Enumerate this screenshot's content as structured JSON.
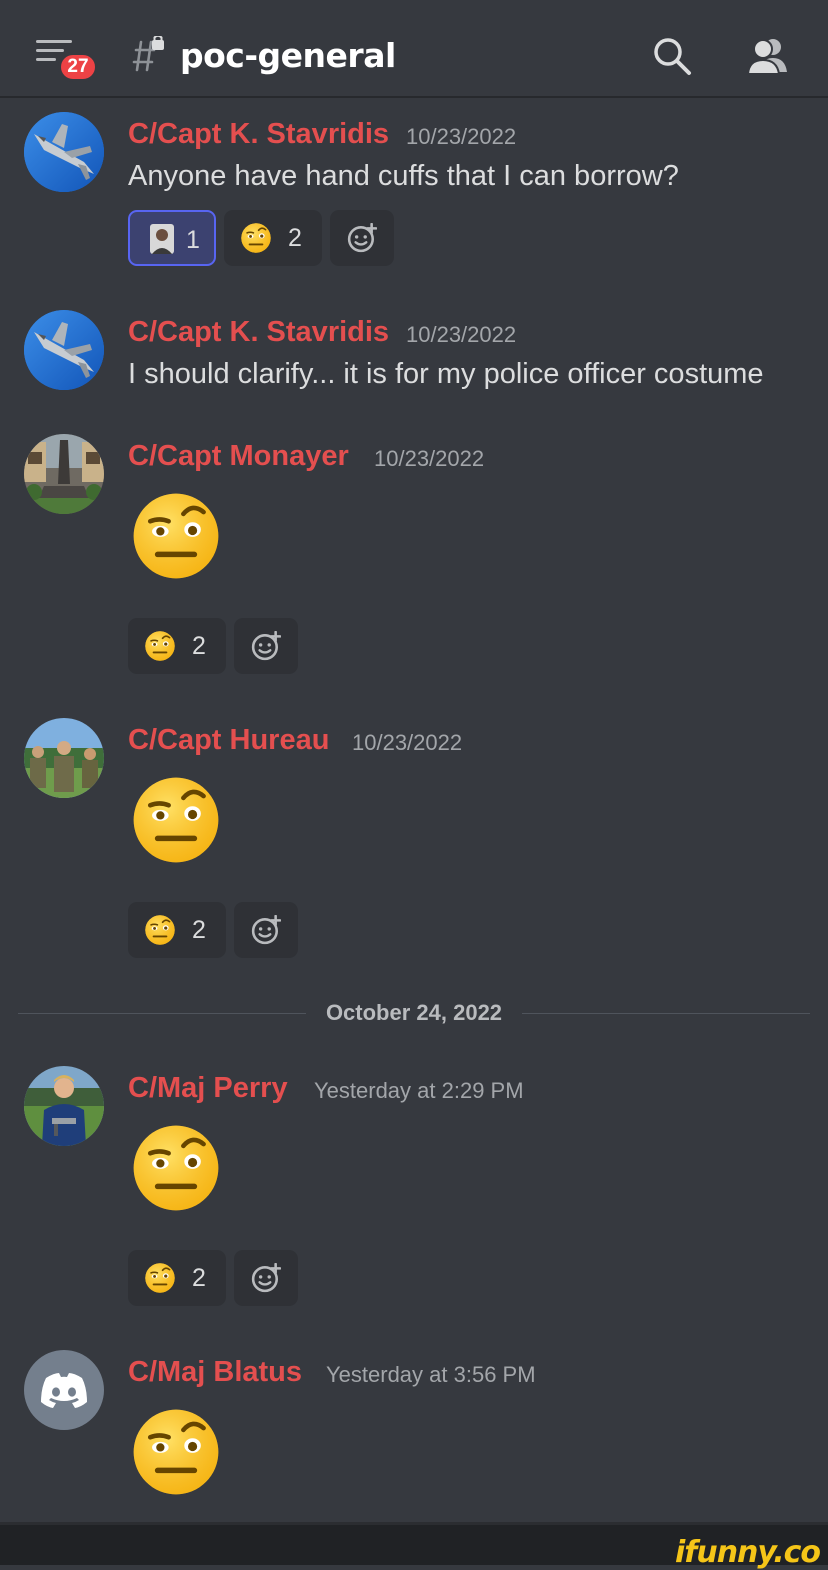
{
  "header": {
    "notification_count": "27",
    "channel_name": "poc-general"
  },
  "colors": {
    "background": "#36393f",
    "author_name": "#e44f4f",
    "timestamp": "#a3a6aa",
    "badge": "#ed4245"
  },
  "messages": [
    {
      "author": "C/Capt K. Stavridis",
      "timestamp": "10/23/2022",
      "text": "Anyone have hand cuffs that I can borrow?",
      "avatar_icon": "jet-avatar",
      "reactions": [
        {
          "icon": "person-photo-emoji",
          "count": "1",
          "self": true
        },
        {
          "icon": "raised-eyebrow-emoji",
          "count": "2",
          "self": false
        }
      ]
    },
    {
      "author": "C/Capt K. Stavridis",
      "timestamp": "10/23/2022",
      "text": "I should clarify... it is for my police officer costume",
      "avatar_icon": "jet-avatar"
    },
    {
      "author": "C/Capt Monayer",
      "timestamp": "10/23/2022",
      "emoji": "raised-eyebrow-emoji",
      "avatar_icon": "monument-avatar",
      "reactions": [
        {
          "icon": "raised-eyebrow-emoji",
          "count": "2"
        }
      ]
    },
    {
      "author": "C/Capt Hureau",
      "timestamp": "10/23/2022",
      "emoji": "raised-eyebrow-emoji",
      "avatar_icon": "group-photo-avatar",
      "reactions": [
        {
          "icon": "raised-eyebrow-emoji",
          "count": "2"
        }
      ]
    },
    {
      "author": "C/Maj Perry",
      "timestamp": "Yesterday at 2:29 PM",
      "emoji": "raised-eyebrow-emoji",
      "avatar_icon": "portrait-avatar",
      "reactions": [
        {
          "icon": "raised-eyebrow-emoji",
          "count": "2"
        }
      ]
    },
    {
      "author": "C/Maj Blatus",
      "timestamp": "Yesterday at 3:56 PM",
      "emoji": "raised-eyebrow-emoji",
      "avatar_icon": "discord-default-avatar"
    }
  ],
  "date_divider": "October 24, 2022",
  "watermark": "ifunny.co"
}
